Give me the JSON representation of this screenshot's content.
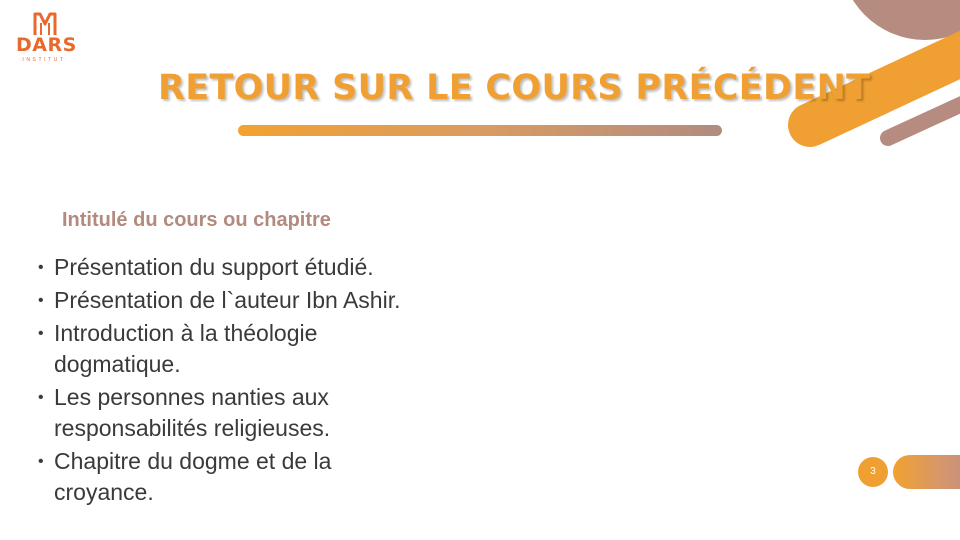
{
  "brand": {
    "logo_text": "DARS",
    "logo_subtext": "INSTITUT",
    "colors": {
      "orange": "#f0a032",
      "mauve": "#b38a7e",
      "logo": "#e9692c"
    }
  },
  "slide": {
    "title": "RETOUR SUR LE COURS PRÉCÉDENT",
    "subtitle": "Intitulé du cours ou chapitre",
    "bullets": [
      "Présentation du support étudié.",
      "Présentation de l`auteur Ibn Ashir.",
      "Introduction à la théologie dogmatique.",
      "Les personnes nanties aux responsabilités religieuses.",
      "Chapitre du dogme et de la croyance."
    ],
    "bullet_symbol": "•",
    "page_number": "3"
  }
}
